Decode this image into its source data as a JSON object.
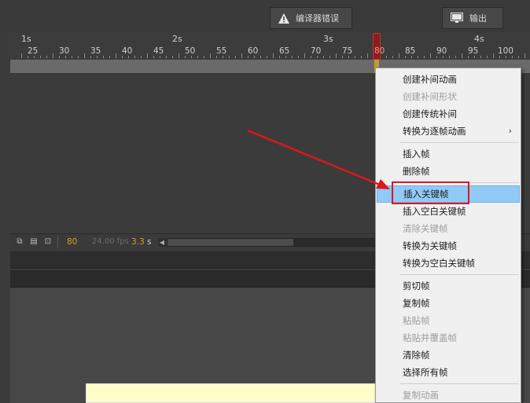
{
  "header": {
    "errors_tab_label": "编译器错误",
    "output_tab_label": "输出"
  },
  "ruler": {
    "seconds": [
      "1s",
      "2s",
      "3s",
      "4s"
    ],
    "frames": [
      "25",
      "30",
      "35",
      "40",
      "45",
      "50",
      "55",
      "60",
      "65",
      "70",
      "75",
      "80",
      "85",
      "90",
      "95",
      "100"
    ],
    "current_frame": "80"
  },
  "timeline_controls": {
    "current_frame": "80",
    "fps": "24.00 fps",
    "time": "3.3",
    "time_unit": "s"
  },
  "context_menu": {
    "items": [
      {
        "label": "创建补间动画",
        "enabled": true
      },
      {
        "label": "创建补间形状",
        "enabled": false
      },
      {
        "label": "创建传统补间",
        "enabled": true
      },
      {
        "label": "转换为逐帧动画",
        "enabled": true,
        "submenu": true
      },
      {
        "label": "插入帧",
        "enabled": true
      },
      {
        "label": "删除帧",
        "enabled": true
      },
      {
        "label": "插入关键帧",
        "enabled": true,
        "highlighted": true
      },
      {
        "label": "插入空白关键帧",
        "enabled": true
      },
      {
        "label": "清除关键帧",
        "enabled": false
      },
      {
        "label": "转换为关键帧",
        "enabled": true
      },
      {
        "label": "转换为空白关键帧",
        "enabled": true
      },
      {
        "label": "剪切帧",
        "enabled": true
      },
      {
        "label": "复制帧",
        "enabled": true
      },
      {
        "label": "粘贴帧",
        "enabled": false
      },
      {
        "label": "粘贴并覆盖帧",
        "enabled": false
      },
      {
        "label": "清除帧",
        "enabled": true
      },
      {
        "label": "选择所有帧",
        "enabled": true
      },
      {
        "label": "复制动画",
        "enabled": false
      }
    ]
  },
  "annotation": {
    "arrow_color": "#e0161a",
    "highlight_box_color": "#e0161a"
  },
  "colors": {
    "menu_highlight": "#91c9f7",
    "frame_accent": "#d4a02c",
    "stage_yellow": "#fffec9"
  }
}
